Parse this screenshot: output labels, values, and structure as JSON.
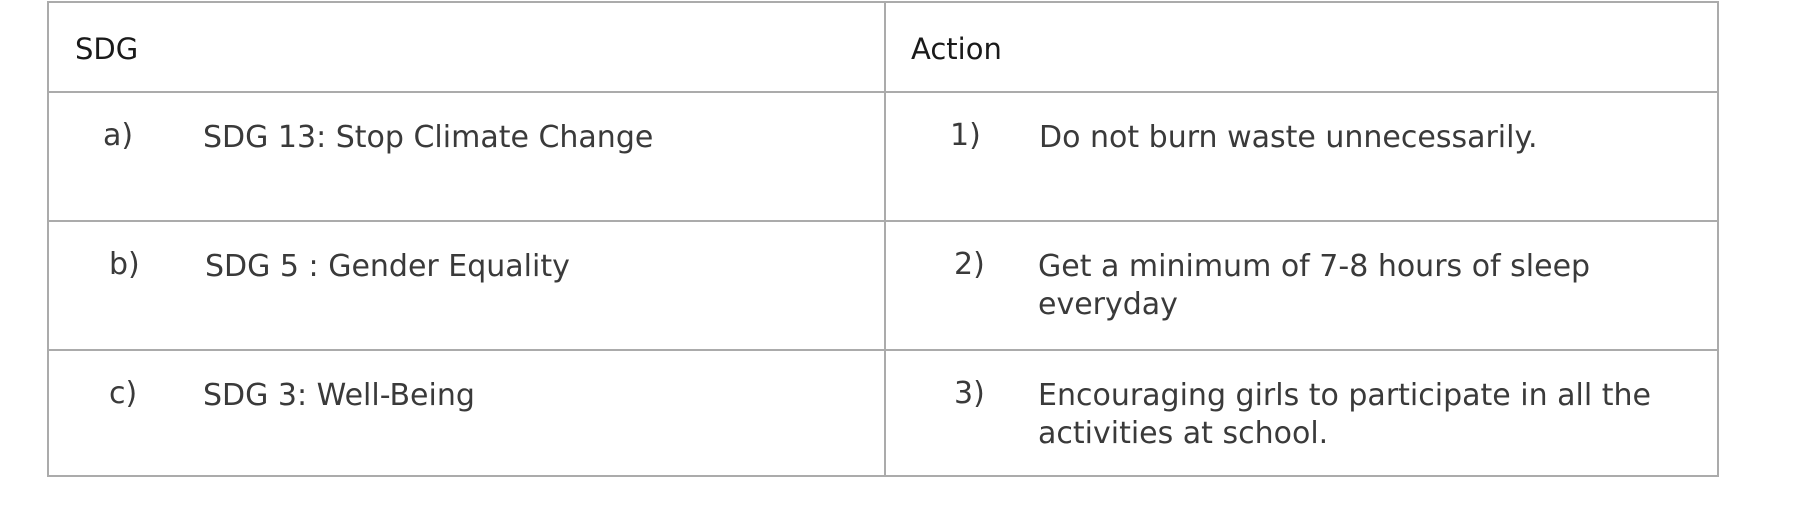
{
  "table": {
    "headers": [
      "SDG",
      "Action"
    ],
    "rows": [
      {
        "sdg_marker": "a)",
        "sdg": "SDG 13: Stop Climate Change",
        "action_marker": "1)",
        "action": "Do not burn waste unnecessarily."
      },
      {
        "sdg_marker": "b)",
        "sdg": "SDG 5 : Gender Equality",
        "action_marker": "2)",
        "action": "Get a minimum of 7-8 hours of sleep everyday"
      },
      {
        "sdg_marker": "c)",
        "sdg": "SDG 3: Well-Being",
        "action_marker": "3)",
        "action": "Encouraging girls to participate in all the activities at school."
      }
    ]
  },
  "colors": {
    "border": "#ababab",
    "text": "#3a3a3a",
    "header_text": "#1a1a1a"
  }
}
